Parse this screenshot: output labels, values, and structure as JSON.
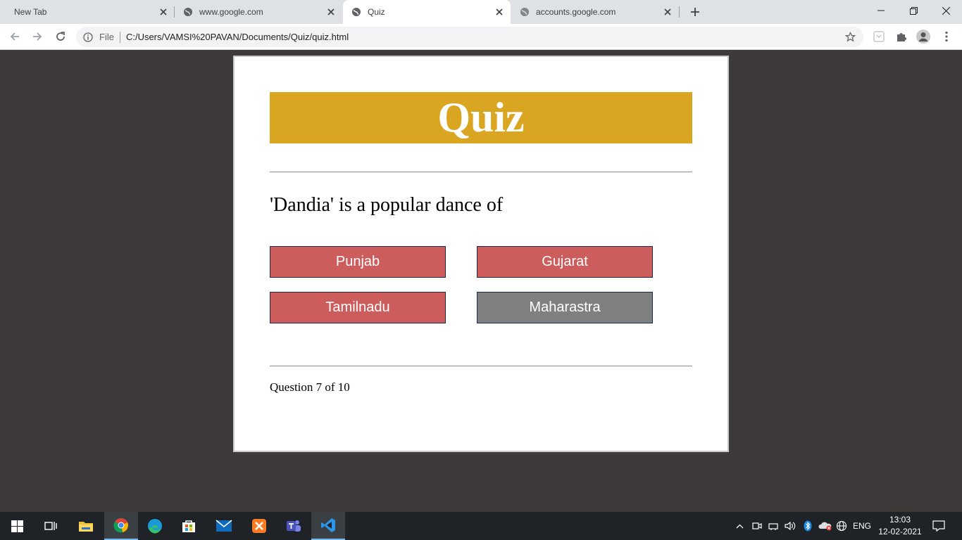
{
  "browser": {
    "tabs": [
      {
        "title": "New Tab"
      },
      {
        "title": "www.google.com"
      },
      {
        "title": "Quiz"
      },
      {
        "title": "accounts.google.com"
      }
    ],
    "address": {
      "scheme_label": "File",
      "url": "C:/Users/VAMSI%20PAVAN/Documents/Quiz/quiz.html"
    }
  },
  "quiz": {
    "title": "Quiz",
    "question": "'Dandia' is a popular dance of",
    "answers": [
      {
        "label": "Punjab",
        "color": "#cd5c5c"
      },
      {
        "label": "Gujarat",
        "color": "#cd5c5c"
      },
      {
        "label": "Tamilnadu",
        "color": "#cd5c5c"
      },
      {
        "label": "Maharastra",
        "color": "#808080"
      }
    ],
    "progress_text": "Question 7 of 10"
  },
  "colors": {
    "heading_bg": "#daa520",
    "page_bg": "#3d3a39",
    "answer_wrong": "#cd5c5c",
    "answer_selected": "#808080"
  },
  "taskbar": {
    "apps": [
      "start-icon",
      "task-view-icon",
      "file-explorer-icon",
      "chrome-icon",
      "edge-icon",
      "store-icon",
      "mail-icon",
      "xampp-icon",
      "teams-icon",
      "vscode-icon"
    ],
    "language": "ENG",
    "time": "13:03",
    "date": "12-02-2021"
  }
}
